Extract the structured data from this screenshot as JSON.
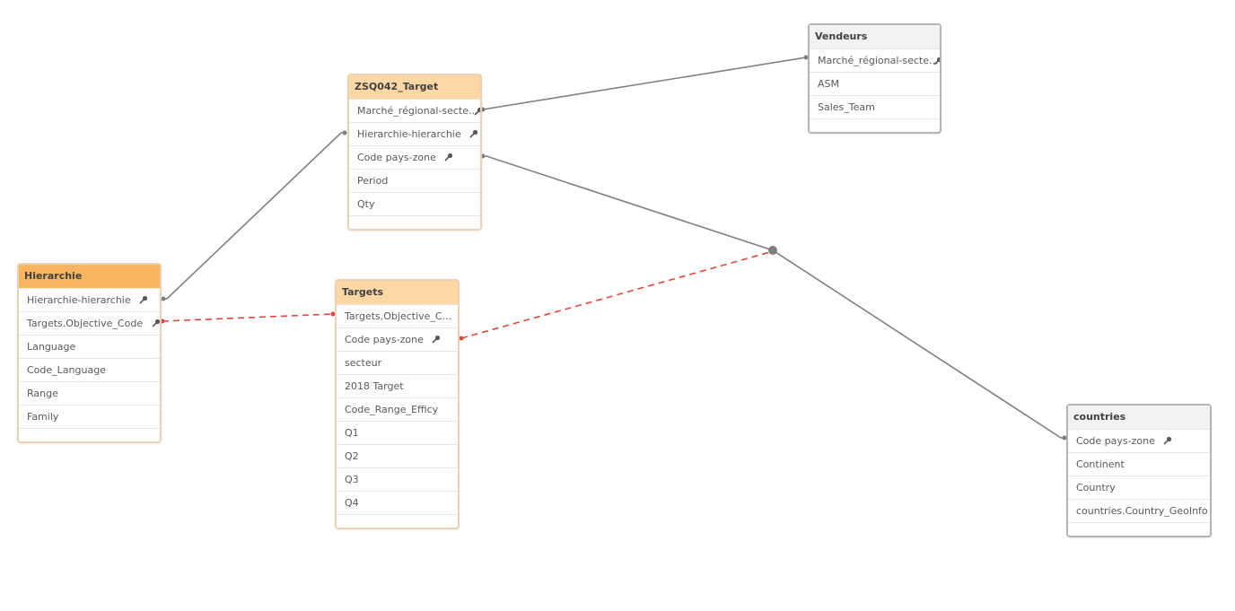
{
  "colors": {
    "link_solid": "#7f7f7f",
    "link_synthetic": "#e0463c",
    "header_dark": "#f9b560",
    "header_light": "#fdd8a5",
    "header_gray": "#f2f2f2"
  },
  "tables": {
    "zsq": {
      "title": "ZSQ042_Target",
      "fields": [
        {
          "label": "Marché_régional-secte...",
          "key": true
        },
        {
          "label": "Hierarchie-hierarchie",
          "key": true
        },
        {
          "label": "Code pays-zone",
          "key": true
        },
        {
          "label": "Period",
          "key": false
        },
        {
          "label": "Qty",
          "key": false
        }
      ]
    },
    "vendeurs": {
      "title": "Vendeurs",
      "fields": [
        {
          "label": "Marché_régional-secte...",
          "key": true
        },
        {
          "label": "ASM",
          "key": false
        },
        {
          "label": "Sales_Team",
          "key": false
        }
      ]
    },
    "hierarchie": {
      "title": "Hierarchie",
      "fields": [
        {
          "label": "Hierarchie-hierarchie",
          "key": true
        },
        {
          "label": "Targets.Objective_Code",
          "key": true
        },
        {
          "label": "Language",
          "key": false
        },
        {
          "label": "Code_Language",
          "key": false
        },
        {
          "label": "Range",
          "key": false
        },
        {
          "label": "Family",
          "key": false
        }
      ]
    },
    "targets": {
      "title": "Targets",
      "fields": [
        {
          "label": "Targets.Objective_C...",
          "key": false
        },
        {
          "label": "Code pays-zone",
          "key": true
        },
        {
          "label": "secteur",
          "key": false
        },
        {
          "label": "2018 Target",
          "key": false
        },
        {
          "label": "Code_Range_Efficy",
          "key": false
        },
        {
          "label": "Q1",
          "key": false
        },
        {
          "label": "Q2",
          "key": false
        },
        {
          "label": "Q3",
          "key": false
        },
        {
          "label": "Q4",
          "key": false
        }
      ]
    },
    "countries": {
      "title": "countries",
      "fields": [
        {
          "label": "Code pays-zone",
          "key": true
        },
        {
          "label": "Continent",
          "key": false
        },
        {
          "label": "Country",
          "key": false
        },
        {
          "label": "countries.Country_GeoInfo",
          "key": false
        }
      ]
    }
  },
  "links": [
    {
      "from": "zsq.Marché_régional-secteur",
      "to": "vendeurs.Marché_régional-secteur",
      "type": "solid"
    },
    {
      "from": "hierarchie.Hierarchie-hierarchie",
      "to": "zsq.Hierarchie-hierarchie",
      "type": "solid"
    },
    {
      "from": "zsq.Code pays-zone",
      "to": "countries.Code pays-zone",
      "type": "solid"
    },
    {
      "from": "hierarchie.Targets.Objective_Code",
      "to": "targets.Targets.Objective_Code",
      "type": "synthetic"
    },
    {
      "from": "targets.Code pays-zone",
      "to": "junction.Code pays-zone",
      "type": "synthetic"
    }
  ]
}
